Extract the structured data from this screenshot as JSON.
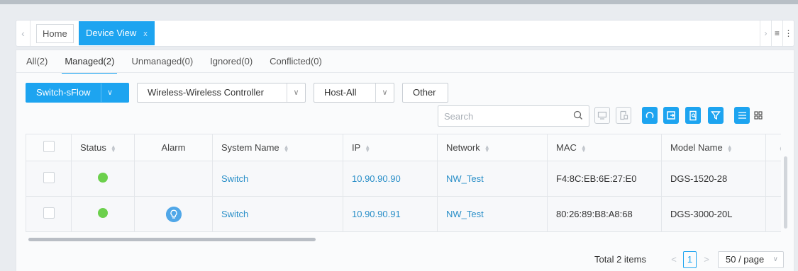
{
  "tabs": {
    "home": "Home",
    "device_view": "Device View",
    "close": "x"
  },
  "subtabs": [
    {
      "label": "All(2)"
    },
    {
      "label": "Managed(2)"
    },
    {
      "label": "Unmanaged(0)"
    },
    {
      "label": "Ignored(0)"
    },
    {
      "label": "Conflicted(0)"
    }
  ],
  "filters": {
    "switch": "Switch-sFlow",
    "wireless": "Wireless-Wireless Controller",
    "host": "Host-All",
    "other": "Other"
  },
  "search": {
    "placeholder": "Search"
  },
  "table": {
    "headers": {
      "status": "Status",
      "alarm": "Alarm",
      "system_name": "System Name",
      "ip": "IP",
      "network": "Network",
      "mac": "MAC",
      "model_name": "Model Name"
    },
    "rows": [
      {
        "status": "online",
        "alarm": false,
        "system_name": "Switch",
        "ip": "10.90.90.90",
        "network": "NW_Test",
        "mac": "F4:8C:EB:6E:27:E0",
        "model_name": "DGS-1520-28"
      },
      {
        "status": "online",
        "alarm": true,
        "system_name": "Switch",
        "ip": "10.90.90.91",
        "network": "NW_Test",
        "mac": "80:26:89:B8:A8:68",
        "model_name": "DGS-3000-20L"
      }
    ]
  },
  "pagination": {
    "total": "Total 2 items",
    "page": "1",
    "page_size": "50 / page"
  },
  "colors": {
    "accent": "#1da4f0",
    "status_online": "#6cd04c",
    "link": "#2a8fc8"
  },
  "icons": [
    "chevron-left-icon",
    "close-icon",
    "chevron-right-icon",
    "menu-icon",
    "trash-icon",
    "search-icon",
    "monitor-icon",
    "report-icon",
    "refresh-icon",
    "export-icon",
    "document-search-icon",
    "filter-icon",
    "list-view-icon",
    "grid-view-icon",
    "sort-icon",
    "bulb-icon"
  ]
}
